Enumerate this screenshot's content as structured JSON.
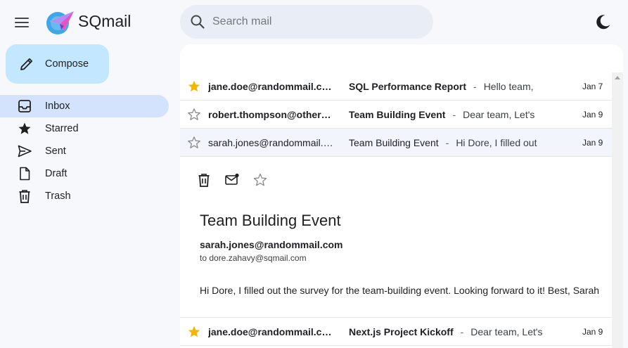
{
  "header": {
    "app_name": "SQmail",
    "search": {
      "placeholder": "Search mail",
      "value": ""
    }
  },
  "sidebar": {
    "compose_label": "Compose",
    "items": [
      {
        "label": "Inbox",
        "icon": "inbox-icon",
        "active": true
      },
      {
        "label": "Starred",
        "icon": "star-icon",
        "active": false
      },
      {
        "label": "Sent",
        "icon": "send-icon",
        "active": false
      },
      {
        "label": "Draft",
        "icon": "draft-icon",
        "active": false
      },
      {
        "label": "Trash",
        "icon": "trash-icon",
        "active": false
      }
    ]
  },
  "emails": [
    {
      "sender": "jane.doe@randommail.com",
      "subject": "SQL Performance Report",
      "snippet": "Hello team,",
      "date": "Jan 7",
      "starred": true,
      "unread": true
    },
    {
      "sender": "robert.thompson@othermail.com",
      "subject": "Team Building Event",
      "snippet": "Dear team, Let's",
      "date": "Jan 9",
      "starred": false,
      "unread": true
    },
    {
      "sender": "sarah.jones@randommail.com",
      "subject": "Team Building Event",
      "snippet": "Hi Dore, I filled out",
      "date": "Jan 9",
      "starred": false,
      "unread": false,
      "selected": true
    },
    {
      "sender": "jane.doe@randommail.com",
      "subject": "Next.js Project Kickoff",
      "snippet": "Dear team, Let's",
      "date": "Jan 9",
      "starred": true,
      "unread": true
    }
  ],
  "separator": "-",
  "opened_email": {
    "subject": "Team Building Event",
    "from": "sarah.jones@randommail.com",
    "to_line": "to dore.zahavy@sqmail.com",
    "body": "Hi Dore, I filled out the survey for the team-building event. Looking forward to it! Best, Sarah",
    "actions": [
      "delete-icon",
      "mark-unread-icon",
      "star-icon"
    ]
  },
  "colors": {
    "background": "#f6f8fc",
    "compose": "#c2e7ff",
    "active_nav": "#d3e3fd",
    "search": "#e9eef6",
    "star_filled": "#f4b400"
  }
}
